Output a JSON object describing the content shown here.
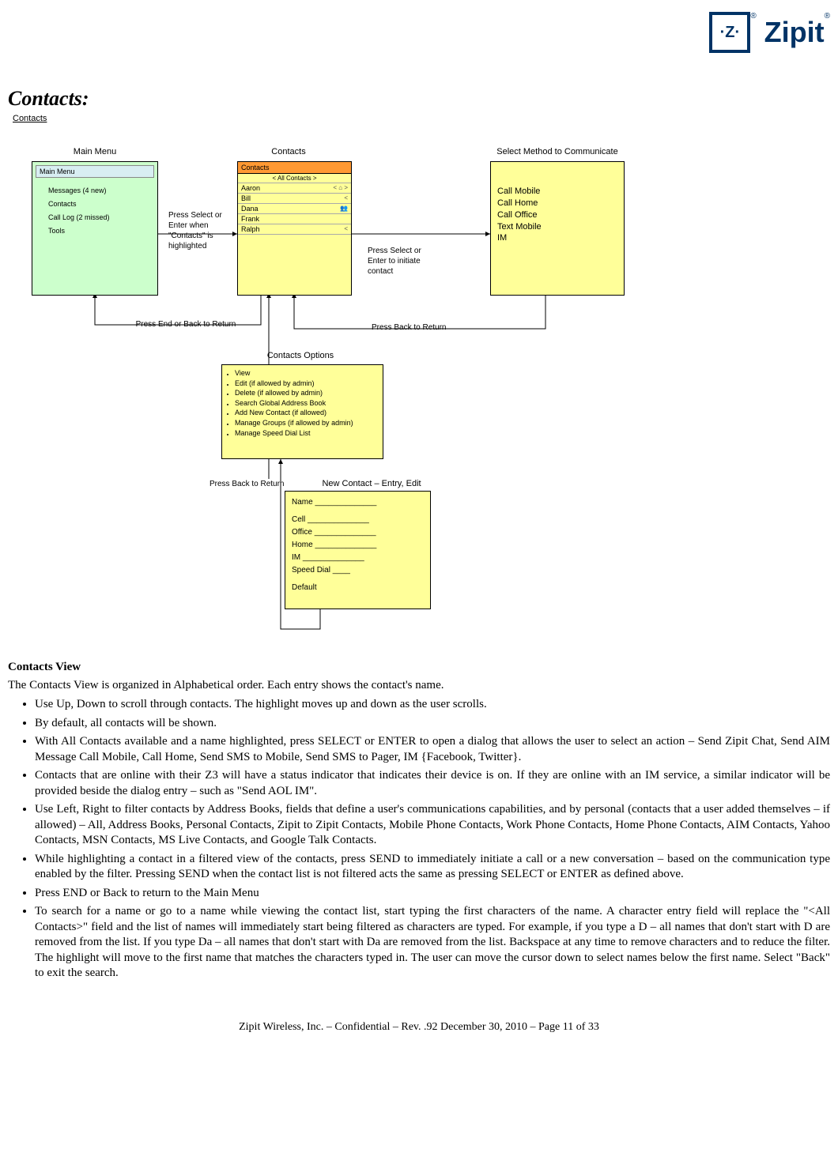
{
  "logo": {
    "symbol": "·Z·",
    "text": "Zipit"
  },
  "title": "Contacts:",
  "sub": "Contacts",
  "labels": {
    "mainMenu": "Main Menu",
    "contacts": "Contacts",
    "selectMethod": "Select Method to Communicate",
    "contactsOptions": "Contacts Options",
    "newContact": "New Contact – Entry, Edit"
  },
  "mainMenu": {
    "header": "Main Menu",
    "items": [
      "Messages   (4 new)",
      "Contacts",
      "Call Log  (2 missed)",
      "Tools"
    ]
  },
  "contactsPanel": {
    "header": "Contacts",
    "filter": "<   All Contacts   >",
    "rows": [
      {
        "name": "Aaron",
        "sym": "<   ⌂   >"
      },
      {
        "name": "Bill",
        "sym": "<"
      },
      {
        "name": "Dana",
        "sym": "👥"
      },
      {
        "name": "Frank",
        "sym": ""
      },
      {
        "name": "Ralph",
        "sym": "<"
      }
    ]
  },
  "selectMethod": {
    "items": [
      "Call Mobile",
      "Call Home",
      "Call Office",
      "Text Mobile",
      "IM"
    ]
  },
  "options": {
    "items": [
      "View",
      "Edit (if allowed by admin)",
      "Delete (if allowed by admin)",
      "Search Global Address Book",
      "Add New Contact (if allowed)",
      "Manage Groups (if allowed by admin)",
      "Manage Speed Dial List"
    ]
  },
  "entry": {
    "name": "Name ______________",
    "cell": "Cell     ______________",
    "office": "Office ______________",
    "home": "Home ______________",
    "im": "IM        ______________",
    "speed": "Speed Dial ____",
    "default": "Default"
  },
  "annots": {
    "a1": "Press Select or Enter when \"Contacts\" is highlighted",
    "a2": "Press Select or Enter to initiate contact",
    "a3": "Press End or Back to Return",
    "a4": "Press Back to Return",
    "a5": "Press Back to Return"
  },
  "section": {
    "heading": "Contacts View",
    "intro": "The Contacts View is organized in Alphabetical order.  Each entry shows the contact's name.",
    "bullets": [
      "Use Up, Down to scroll through contacts.  The highlight moves up and down as the user scrolls.",
      "By default, all contacts will be shown.",
      "With All Contacts available and a name highlighted, press SELECT or ENTER to open a dialog that allows the user to select an action – Send Zipit Chat, Send AIM Message  Call Mobile, Call Home, Send SMS to Mobile, Send SMS to Pager, IM {Facebook, Twitter}.",
      " Contacts that are online with their Z3 will have a status indicator that indicates their device is on.  If they are online with an IM service, a similar indicator will be provided beside the dialog entry – such as \"Send AOL IM\".",
      "Use Left, Right to filter contacts by Address Books, fields that define a user's communications capabilities, and by personal (contacts that a user added themselves – if allowed) – All, Address Books, Personal Contacts, Zipit to Zipit Contacts, Mobile Phone Contacts, Work Phone Contacts, Home Phone Contacts, AIM Contacts, Yahoo Contacts, MSN Contacts, MS Live Contacts, and Google Talk Contacts.",
      " While highlighting a contact in a filtered view of the contacts, press SEND to immediately initiate a call or a new conversation – based on the communication type enabled by the filter.  Pressing SEND when the contact list is not filtered acts the same as pressing SELECT or ENTER as defined above.",
      "Press END or Back to return to the Main Menu",
      "To search for a name or go to a name while viewing the contact list, start typing the first characters of the name.  A character entry field will replace the \"<All Contacts>\" field and the list of names will immediately start being filtered as characters are typed.  For example, if you type a D – all names that don't start with D are removed from the list.  If you type Da – all names that don't start with Da are removed from the list.  Backspace at any time to remove characters and to reduce the filter.  The highlight will move to the first name that matches the characters typed in. The user can move the cursor down to select names below the first name.  Select \"Back\" to exit the search."
    ]
  },
  "footer": "Zipit Wireless, Inc. – Confidential – Rev. .92 December 30, 2010 – Page 11 of 33"
}
